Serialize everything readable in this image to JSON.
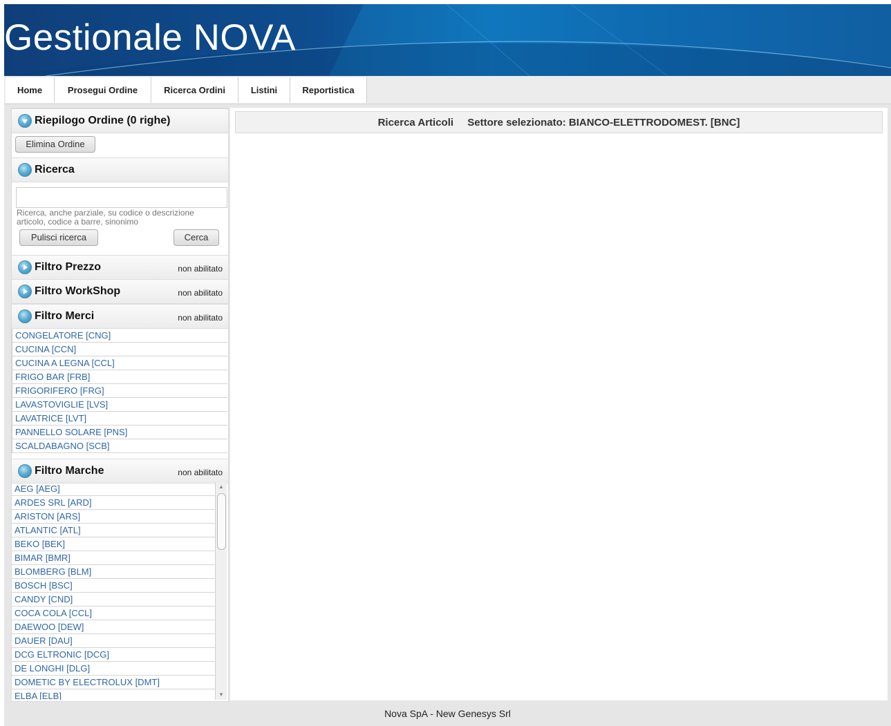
{
  "app": {
    "title": "Gestionale NOVA"
  },
  "nav": [
    {
      "label": "Home"
    },
    {
      "label": "Prosegui Ordine"
    },
    {
      "label": "Ricerca Ordini"
    },
    {
      "label": "Listini"
    },
    {
      "label": "Reportistica"
    }
  ],
  "summary": {
    "title": "Riepilogo Ordine (0 righe)",
    "delete_label": "Elimina Ordine"
  },
  "search": {
    "title": "Ricerca",
    "input_value": "",
    "hint": "Ricerca, anche parziale, su codice o descrizione articolo, codice a barre, sinonimo",
    "clear_label": "Pulisci ricerca",
    "search_label": "Cerca"
  },
  "filters": {
    "price": {
      "title": "Filtro Prezzo",
      "status": "non abilitato"
    },
    "workshop": {
      "title": "Filtro WorkShop",
      "status": "non abilitato"
    },
    "goods": {
      "title": "Filtro Merci",
      "status": "non abilitato",
      "items": [
        "CONGELATORE [CNG]",
        "CUCINA [CCN]",
        "CUCINA A LEGNA [CCL]",
        "FRIGO BAR [FRB]",
        "FRIGORIFERO [FRG]",
        "LAVASTOVIGLIE [LVS]",
        "LAVATRICE [LVT]",
        "PANNELLO SOLARE [PNS]",
        "SCALDABAGNO [SCB]"
      ]
    },
    "brands": {
      "title": "Filtro Marche",
      "status": "non abilitato",
      "items": [
        "AEG [AEG]",
        "ARDES SRL [ARD]",
        "ARISTON [ARS]",
        "ATLANTIC [ATL]",
        "BEKO [BEK]",
        "BIMAR [BMR]",
        "BLOMBERG [BLM]",
        "BOSCH [BSC]",
        "CANDY [CND]",
        "COCA COLA [CCL]",
        "DAEWOO [DEW]",
        "DAUER [DAU]",
        "DCG ELTRONIC [DCG]",
        "DE LONGHI [DLG]",
        "DOMETIC BY ELECTROLUX [DMT]",
        "ELBA [ELB]"
      ]
    }
  },
  "main": {
    "heading": "Ricerca Articoli",
    "sector": "Settore selezionato: BIANCO-ELETTRODOMEST. [BNC]"
  },
  "footer": {
    "text": "Nova SpA - New Genesys Srl"
  },
  "colors": {
    "banner": "#0e4d8f",
    "link": "#2f66a8"
  }
}
